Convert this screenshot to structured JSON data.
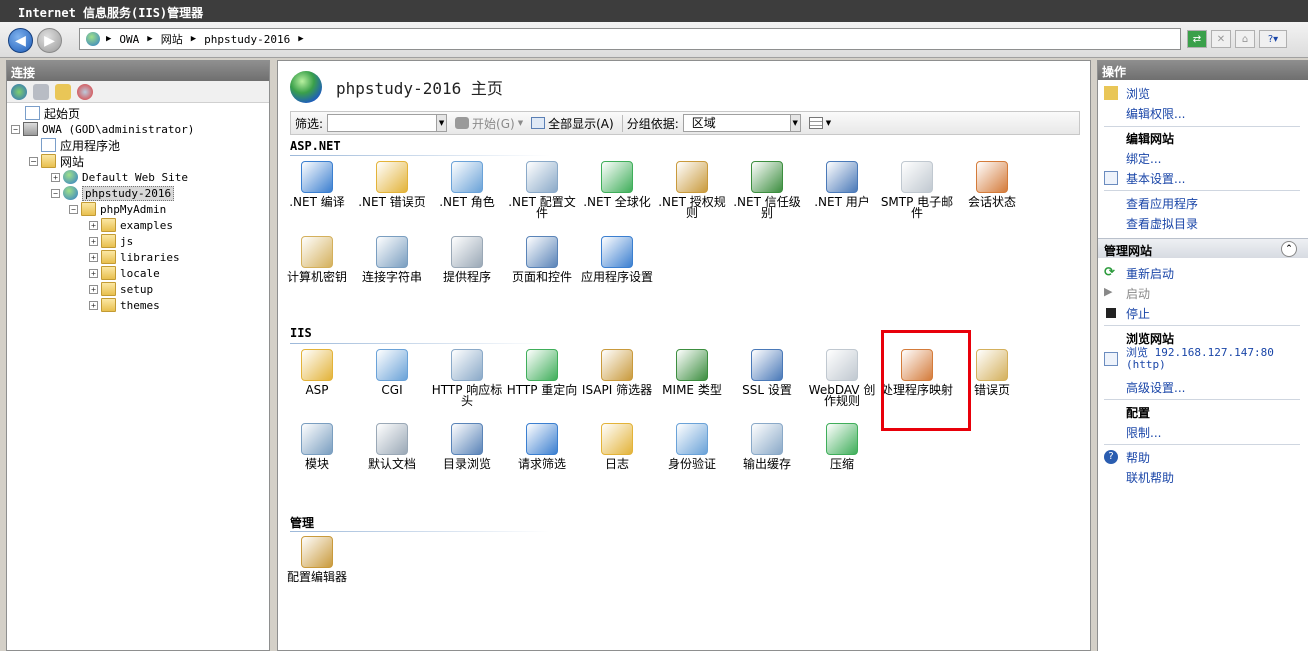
{
  "window": {
    "title": "Internet 信息服务(IIS)管理器"
  },
  "address": {
    "crumbs": [
      "OWA",
      "网站",
      "phpstudy-2016"
    ]
  },
  "connections": {
    "title": "连接",
    "tree": [
      {
        "label": "起始页"
      },
      {
        "label": "OWA (GOD\\administrator)"
      },
      {
        "label": "应用程序池"
      },
      {
        "label": "网站"
      },
      {
        "label": "Default Web Site"
      },
      {
        "label": "phpstudy-2016"
      },
      {
        "label": "phpMyAdmin"
      },
      {
        "label": "examples"
      },
      {
        "label": "js"
      },
      {
        "label": "libraries"
      },
      {
        "label": "locale"
      },
      {
        "label": "setup"
      },
      {
        "label": "themes"
      }
    ]
  },
  "main": {
    "title": "phpstudy-2016 主页",
    "filter_label": "筛选:",
    "start_label": "开始(G)",
    "showall_label": "全部显示(A)",
    "groupby_label": "分组依据:",
    "groupby_value": "区域",
    "sections": [
      {
        "name": "ASP.NET",
        "items": [
          ".NET 编译",
          ".NET 错误页",
          ".NET 角色",
          ".NET 配置文件",
          ".NET 全球化",
          ".NET 授权规则",
          ".NET 信任级别",
          ".NET 用户",
          "SMTP 电子邮件",
          "会话状态",
          "计算机密钥",
          "连接字符串",
          "提供程序",
          "页面和控件",
          "应用程序设置"
        ]
      },
      {
        "name": "IIS",
        "items": [
          "ASP",
          "CGI",
          "HTTP 响应标头",
          "HTTP 重定向",
          "ISAPI 筛选器",
          "MIME 类型",
          "SSL 设置",
          "WebDAV 创作规则",
          "处理程序映射",
          "错误页",
          "模块",
          "默认文档",
          "目录浏览",
          "请求筛选",
          "日志",
          "身份验证",
          "输出缓存",
          "压缩"
        ]
      },
      {
        "name": "管理",
        "items": [
          "配置编辑器"
        ]
      }
    ]
  },
  "actions": {
    "title": "操作",
    "browse": "浏览",
    "edit_perms": "编辑权限...",
    "edit_site": "编辑网站",
    "bindings": "绑定...",
    "basic_settings": "基本设置...",
    "view_apps": "查看应用程序",
    "view_vdirs": "查看虚拟目录",
    "manage_site": "管理网站",
    "restart": "重新启动",
    "start": "启动",
    "stop": "停止",
    "browse_site": "浏览网站",
    "browse_url": "浏览 192.168.127.147:80 (http)",
    "advanced": "高级设置...",
    "config": "配置",
    "limits": "限制...",
    "help": "帮助",
    "online_help": "联机帮助"
  }
}
